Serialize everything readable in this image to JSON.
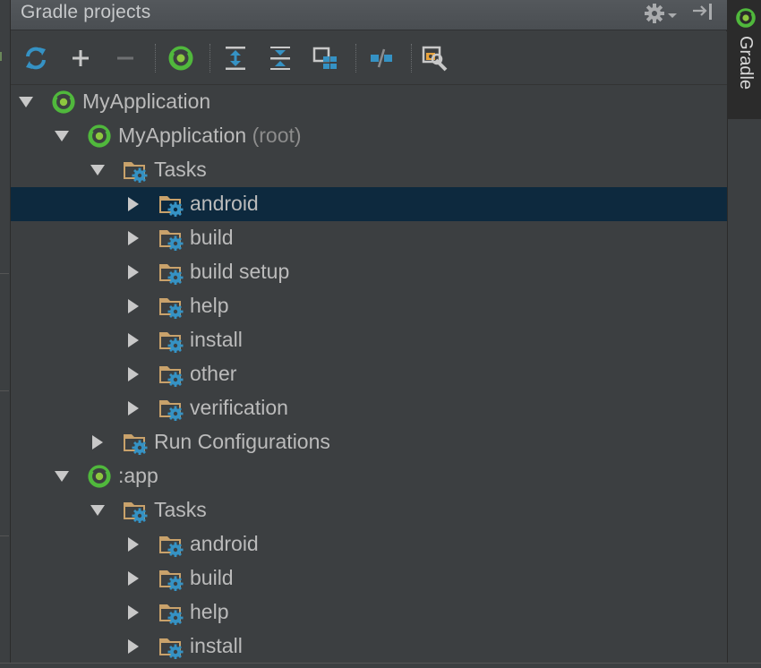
{
  "panel": {
    "title": "Gradle projects",
    "header_icons": [
      "gear-icon",
      "chevron-down-icon",
      "hide-panel-icon"
    ]
  },
  "toolbar": {
    "buttons": [
      {
        "name": "refresh-all-button",
        "icon": "refresh-icon",
        "color": "#3592c4"
      },
      {
        "name": "attach-project-button",
        "icon": "plus-icon",
        "color": "#c8c8c8"
      },
      {
        "name": "detach-project-button",
        "icon": "minus-icon",
        "color": "#7a7a7a"
      },
      {
        "name": "execute-task-button",
        "icon": "gradle-icon",
        "color": "#50b83c"
      },
      {
        "name": "expand-all-button",
        "icon": "expand-all-icon",
        "color": "#3592c4"
      },
      {
        "name": "collapse-all-button",
        "icon": "collapse-all-icon",
        "color": "#3592c4"
      },
      {
        "name": "group-tasks-button",
        "icon": "group-icon",
        "color": "#3592c4"
      },
      {
        "name": "toggle-offline-button",
        "icon": "offline-icon",
        "color": "#3592c4"
      },
      {
        "name": "gradle-settings-button",
        "icon": "wrench-icon",
        "color": "#e8a33d"
      }
    ]
  },
  "tree": {
    "rows": [
      {
        "label": "MyApplication",
        "sub": "",
        "icon": "gradle-icon",
        "level": 0,
        "expanded": true,
        "selected": false
      },
      {
        "label": "MyApplication",
        "sub": " (root)",
        "icon": "gradle-icon",
        "level": 1,
        "expanded": true,
        "selected": false
      },
      {
        "label": "Tasks",
        "sub": "",
        "icon": "task-folder-icon",
        "level": 2,
        "expanded": true,
        "selected": false
      },
      {
        "label": "android",
        "sub": "",
        "icon": "task-folder-icon",
        "level": 3,
        "expanded": false,
        "selected": true
      },
      {
        "label": "build",
        "sub": "",
        "icon": "task-folder-icon",
        "level": 3,
        "expanded": false,
        "selected": false
      },
      {
        "label": "build setup",
        "sub": "",
        "icon": "task-folder-icon",
        "level": 3,
        "expanded": false,
        "selected": false
      },
      {
        "label": "help",
        "sub": "",
        "icon": "task-folder-icon",
        "level": 3,
        "expanded": false,
        "selected": false
      },
      {
        "label": "install",
        "sub": "",
        "icon": "task-folder-icon",
        "level": 3,
        "expanded": false,
        "selected": false
      },
      {
        "label": "other",
        "sub": "",
        "icon": "task-folder-icon",
        "level": 3,
        "expanded": false,
        "selected": false
      },
      {
        "label": "verification",
        "sub": "",
        "icon": "task-folder-icon",
        "level": 3,
        "expanded": false,
        "selected": false
      },
      {
        "label": "Run Configurations",
        "sub": "",
        "icon": "task-folder-icon",
        "level": 2,
        "expanded": false,
        "selected": false
      },
      {
        "label": ":app",
        "sub": "",
        "icon": "gradle-icon",
        "level": 1,
        "expanded": true,
        "selected": false
      },
      {
        "label": "Tasks",
        "sub": "",
        "icon": "task-folder-icon",
        "level": 2,
        "expanded": true,
        "selected": false
      },
      {
        "label": "android",
        "sub": "",
        "icon": "task-folder-icon",
        "level": 3,
        "expanded": false,
        "selected": false
      },
      {
        "label": "build",
        "sub": "",
        "icon": "task-folder-icon",
        "level": 3,
        "expanded": false,
        "selected": false
      },
      {
        "label": "help",
        "sub": "",
        "icon": "task-folder-icon",
        "level": 3,
        "expanded": false,
        "selected": false
      },
      {
        "label": "install",
        "sub": "",
        "icon": "task-folder-icon",
        "level": 3,
        "expanded": false,
        "selected": false
      }
    ]
  },
  "side_tab": {
    "label": "Gradle",
    "icon": "gradle-icon"
  },
  "colors": {
    "panel_bg": "#3c3f41",
    "selection": "#0d293e",
    "gradle_green": "#50b83c",
    "folder": "#c9a26b",
    "gear_blue": "#3592c4"
  }
}
